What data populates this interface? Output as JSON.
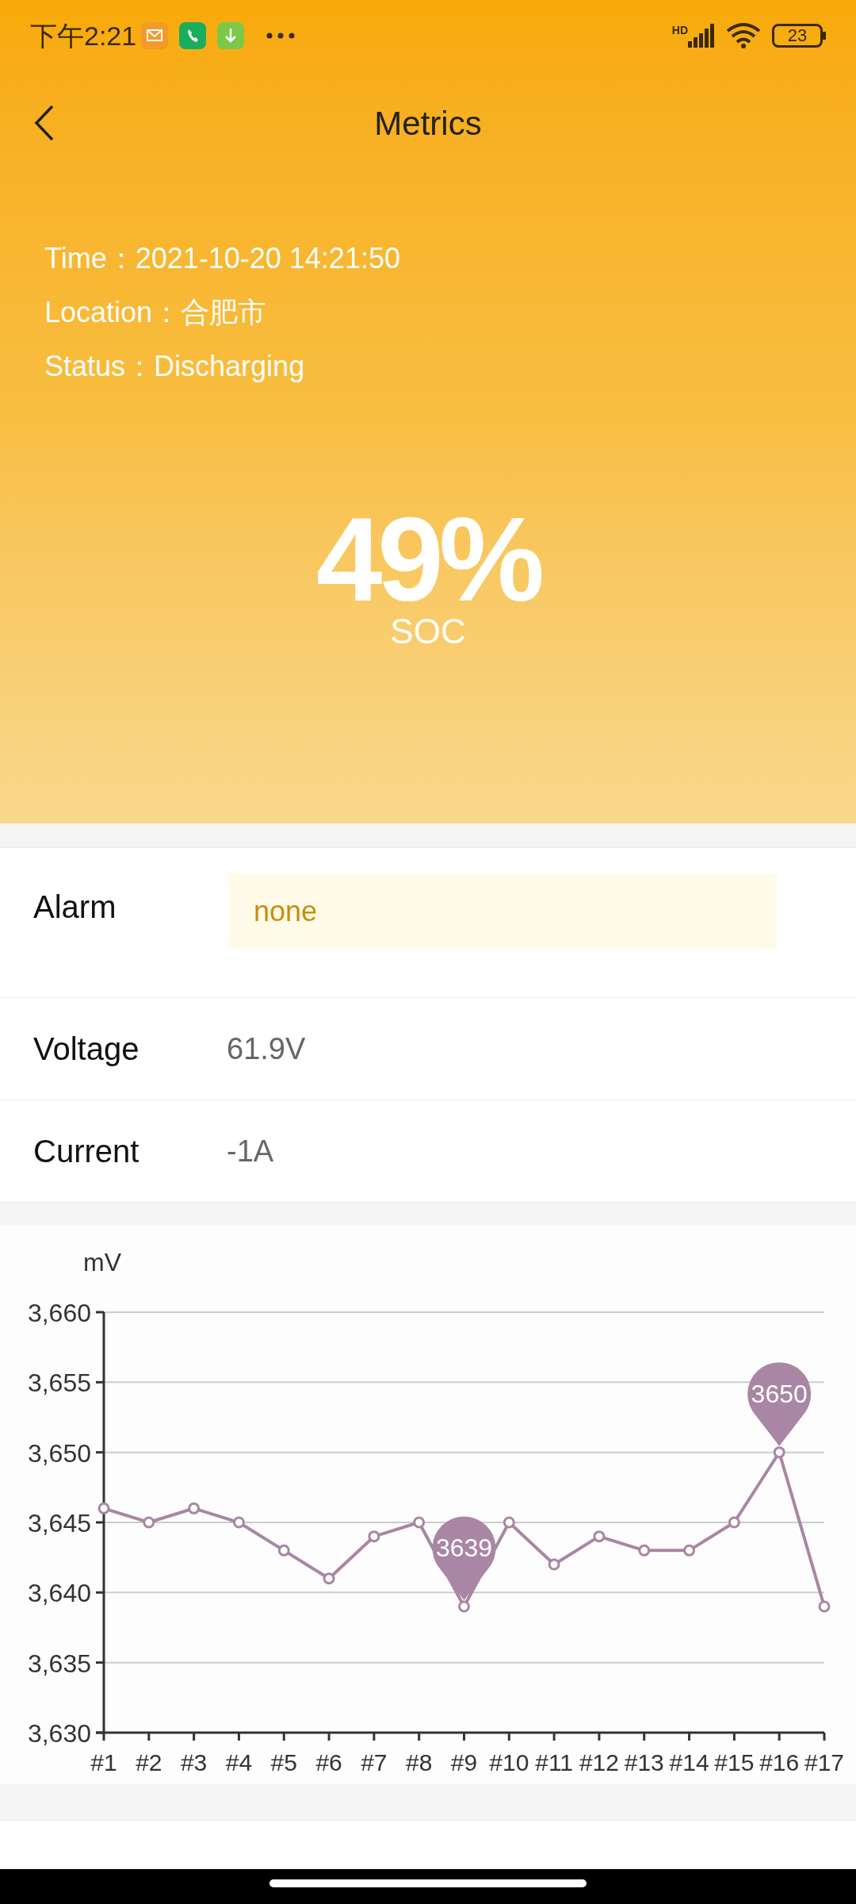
{
  "status_bar": {
    "time": "下午2:21",
    "network": "HD",
    "battery": "23"
  },
  "header": {
    "title": "Metrics"
  },
  "info": [
    {
      "label": "Time：",
      "value": "2021-10-20 14:21:50"
    },
    {
      "label": "Location：",
      "value": "合肥市"
    },
    {
      "label": "Status：",
      "value": "Discharging"
    }
  ],
  "soc": {
    "value": "49%",
    "label": "SOC"
  },
  "alarm": {
    "label": "Alarm",
    "value": "none"
  },
  "metrics": [
    {
      "label": "Voltage",
      "value": "61.9V"
    },
    {
      "label": "Current",
      "value": "-1A"
    }
  ],
  "chart": {
    "chart_data": {
      "type": "line",
      "ylabel": "mV",
      "categories": [
        "#1",
        "#2",
        "#3",
        "#4",
        "#5",
        "#6",
        "#7",
        "#8",
        "#9",
        "#10",
        "#11",
        "#12",
        "#13",
        "#14",
        "#15",
        "#16",
        "#17"
      ],
      "grid": true,
      "series": [
        {
          "color": "#a886a4",
          "marker": "circle",
          "values": [
            3646,
            3645,
            3646,
            3645,
            3643,
            3641,
            3644,
            3645,
            3639,
            3645,
            3642,
            3644,
            3643,
            3643,
            3645,
            3650,
            3639
          ]
        }
      ],
      "ylim": [
        3630,
        3660
      ],
      "yticks": [
        {
          "value": 3630,
          "label": "3,630"
        },
        {
          "value": 3635,
          "label": "3,635"
        },
        {
          "value": 3640,
          "label": "3,640"
        },
        {
          "value": 3645,
          "label": "3,645"
        },
        {
          "value": 3650,
          "label": "3,650"
        },
        {
          "value": 3655,
          "label": "3,655"
        },
        {
          "value": 3660,
          "label": "3,660"
        }
      ],
      "annotations": [
        {
          "x": "#9",
          "y": 3639,
          "text": "3639"
        },
        {
          "x": "#16",
          "y": 3650,
          "text": "3650"
        }
      ]
    }
  }
}
